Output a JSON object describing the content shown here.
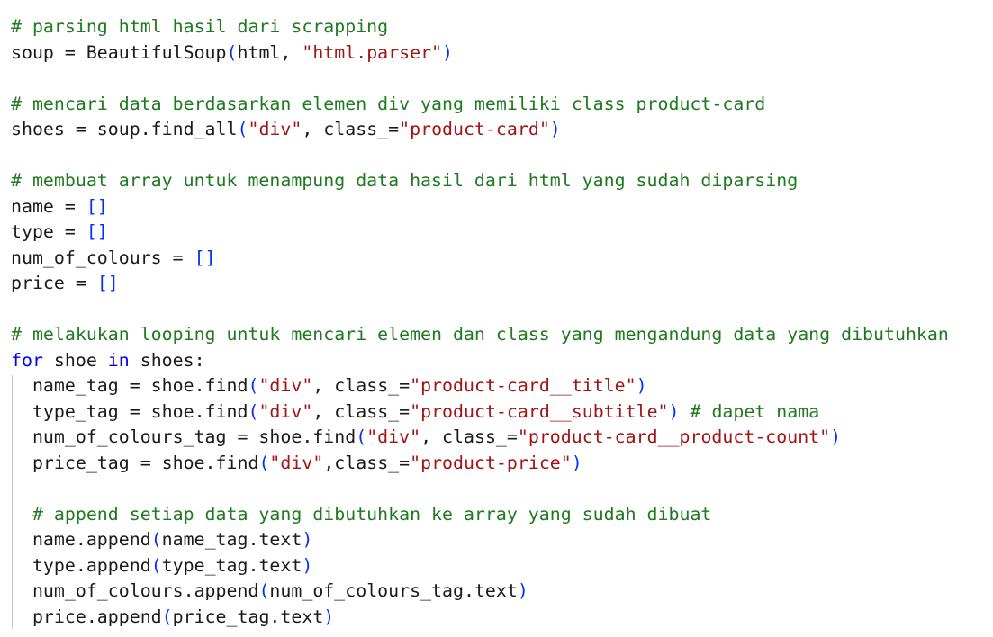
{
  "editor": {
    "lines": [
      [
        {
          "t": "# parsing html hasil dari scrapping",
          "c": "c"
        }
      ],
      [
        {
          "t": "soup = BeautifulSoup",
          "c": "p"
        },
        {
          "t": "(",
          "c": "b"
        },
        {
          "t": "html, ",
          "c": "p"
        },
        {
          "t": "\"html.parser\"",
          "c": "s"
        },
        {
          "t": ")",
          "c": "b"
        }
      ],
      [],
      [
        {
          "t": "# mencari data berdasarkan elemen div yang memiliki class product-card",
          "c": "c"
        }
      ],
      [
        {
          "t": "shoes = soup.find_all",
          "c": "p"
        },
        {
          "t": "(",
          "c": "b"
        },
        {
          "t": "\"div\"",
          "c": "s"
        },
        {
          "t": ", class_=",
          "c": "p"
        },
        {
          "t": "\"product-card\"",
          "c": "s"
        },
        {
          "t": ")",
          "c": "b"
        }
      ],
      [],
      [
        {
          "t": "# membuat array untuk menampung data hasil dari html yang sudah diparsing",
          "c": "c"
        }
      ],
      [
        {
          "t": "name = ",
          "c": "p"
        },
        {
          "t": "[]",
          "c": "b"
        }
      ],
      [
        {
          "t": "type = ",
          "c": "p"
        },
        {
          "t": "[]",
          "c": "b"
        }
      ],
      [
        {
          "t": "num_of_colours = ",
          "c": "p"
        },
        {
          "t": "[]",
          "c": "b"
        }
      ],
      [
        {
          "t": "price = ",
          "c": "p"
        },
        {
          "t": "[]",
          "c": "b"
        }
      ],
      [],
      [
        {
          "t": "# melakukan looping untuk mencari elemen dan class yang mengandung data yang dibutuhkan",
          "c": "c"
        }
      ],
      [
        {
          "t": "for",
          "c": "k"
        },
        {
          "t": " shoe ",
          "c": "p"
        },
        {
          "t": "in",
          "c": "k"
        },
        {
          "t": " shoes:",
          "c": "p"
        }
      ],
      [
        {
          "t": "  name_tag = shoe.find",
          "c": "p"
        },
        {
          "t": "(",
          "c": "b"
        },
        {
          "t": "\"div\"",
          "c": "s"
        },
        {
          "t": ", class_=",
          "c": "p"
        },
        {
          "t": "\"product-card__title\"",
          "c": "s"
        },
        {
          "t": ")",
          "c": "b"
        }
      ],
      [
        {
          "t": "  type_tag = shoe.find",
          "c": "p"
        },
        {
          "t": "(",
          "c": "b"
        },
        {
          "t": "\"div\"",
          "c": "s"
        },
        {
          "t": ", class_=",
          "c": "p"
        },
        {
          "t": "\"product-card__subtitle\"",
          "c": "s"
        },
        {
          "t": ")",
          "c": "b"
        },
        {
          "t": " ",
          "c": "p"
        },
        {
          "t": "# dapet nama",
          "c": "c"
        }
      ],
      [
        {
          "t": "  num_of_colours_tag = shoe.find",
          "c": "p"
        },
        {
          "t": "(",
          "c": "b"
        },
        {
          "t": "\"div\"",
          "c": "s"
        },
        {
          "t": ", class_=",
          "c": "p"
        },
        {
          "t": "\"product-card__product-count\"",
          "c": "s"
        },
        {
          "t": ")",
          "c": "b"
        }
      ],
      [
        {
          "t": "  price_tag = shoe.find",
          "c": "p"
        },
        {
          "t": "(",
          "c": "b"
        },
        {
          "t": "\"div\"",
          "c": "s"
        },
        {
          "t": ",class_=",
          "c": "p"
        },
        {
          "t": "\"product-price\"",
          "c": "s"
        },
        {
          "t": ")",
          "c": "b"
        }
      ],
      [],
      [
        {
          "t": "  ",
          "c": "p"
        },
        {
          "t": "# append setiap data yang dibutuhkan ke array yang sudah dibuat",
          "c": "c"
        }
      ],
      [
        {
          "t": "  name.append",
          "c": "p"
        },
        {
          "t": "(",
          "c": "b"
        },
        {
          "t": "name_tag.text",
          "c": "p"
        },
        {
          "t": ")",
          "c": "b"
        }
      ],
      [
        {
          "t": "  type.append",
          "c": "p"
        },
        {
          "t": "(",
          "c": "b"
        },
        {
          "t": "type_tag.text",
          "c": "p"
        },
        {
          "t": ")",
          "c": "b"
        }
      ],
      [
        {
          "t": "  num_of_colours.append",
          "c": "p"
        },
        {
          "t": "(",
          "c": "b"
        },
        {
          "t": "num_of_colours_tag.text",
          "c": "p"
        },
        {
          "t": ")",
          "c": "b"
        }
      ],
      [
        {
          "t": "  price.append",
          "c": "p"
        },
        {
          "t": "(",
          "c": "b"
        },
        {
          "t": "price_tag.text",
          "c": "p"
        },
        {
          "t": ")",
          "c": "b"
        }
      ]
    ]
  },
  "colors": {
    "comment": "#1e7a1e",
    "string": "#a31515",
    "keyword": "#0000ff",
    "bracket": "#0431fa",
    "plain": "#1a1a1a",
    "background": "#ffffff"
  }
}
